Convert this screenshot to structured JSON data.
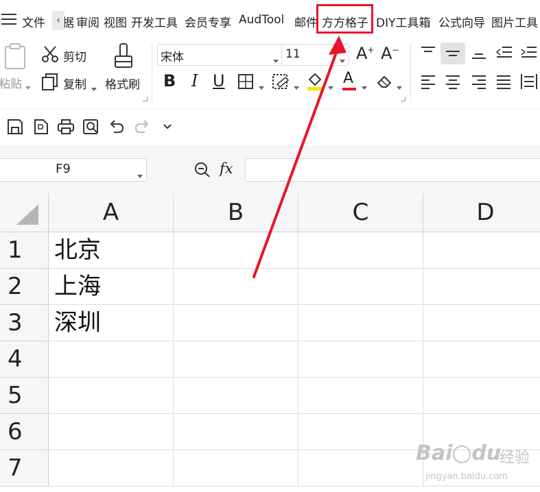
{
  "menu": {
    "items": [
      "文件",
      "据",
      "审阅",
      "视图",
      "开发工具",
      "会员专享",
      "AudTool",
      "邮件",
      "方方格子",
      "DIY工具箱",
      "公式向导",
      "图片工具"
    ],
    "scroll_left": "‹"
  },
  "ribbon": {
    "paste_label": "粘贴",
    "cut_label": "剪切",
    "copy_label": "复制",
    "format_painter_label": "格式刷",
    "font_name": "宋体",
    "font_size": "11",
    "bold": "B",
    "italic": "I",
    "underline": "U",
    "grow_font": "A",
    "shrink_font": "A",
    "font_color_glyph": "A",
    "colors": {
      "accent_red": "#e8142b",
      "highlight_yellow": "#f2e600"
    }
  },
  "formula_bar": {
    "name_box": "F9",
    "fx_label": "fx",
    "formula": ""
  },
  "sheet": {
    "columns": [
      "A",
      "B",
      "C",
      "D"
    ],
    "rows": [
      "1",
      "2",
      "3",
      "4",
      "5",
      "6",
      "7"
    ],
    "cells": {
      "A1": "北京",
      "A2": "上海",
      "A3": "深圳"
    }
  },
  "annotation": {
    "highlighted_tab": "方方格子",
    "arrow_color": "#e8142b"
  },
  "watermark": {
    "brand": "Bai",
    "brand2": "du",
    "brand_cn": "经验",
    "url": "jingyan.baidu.com"
  }
}
